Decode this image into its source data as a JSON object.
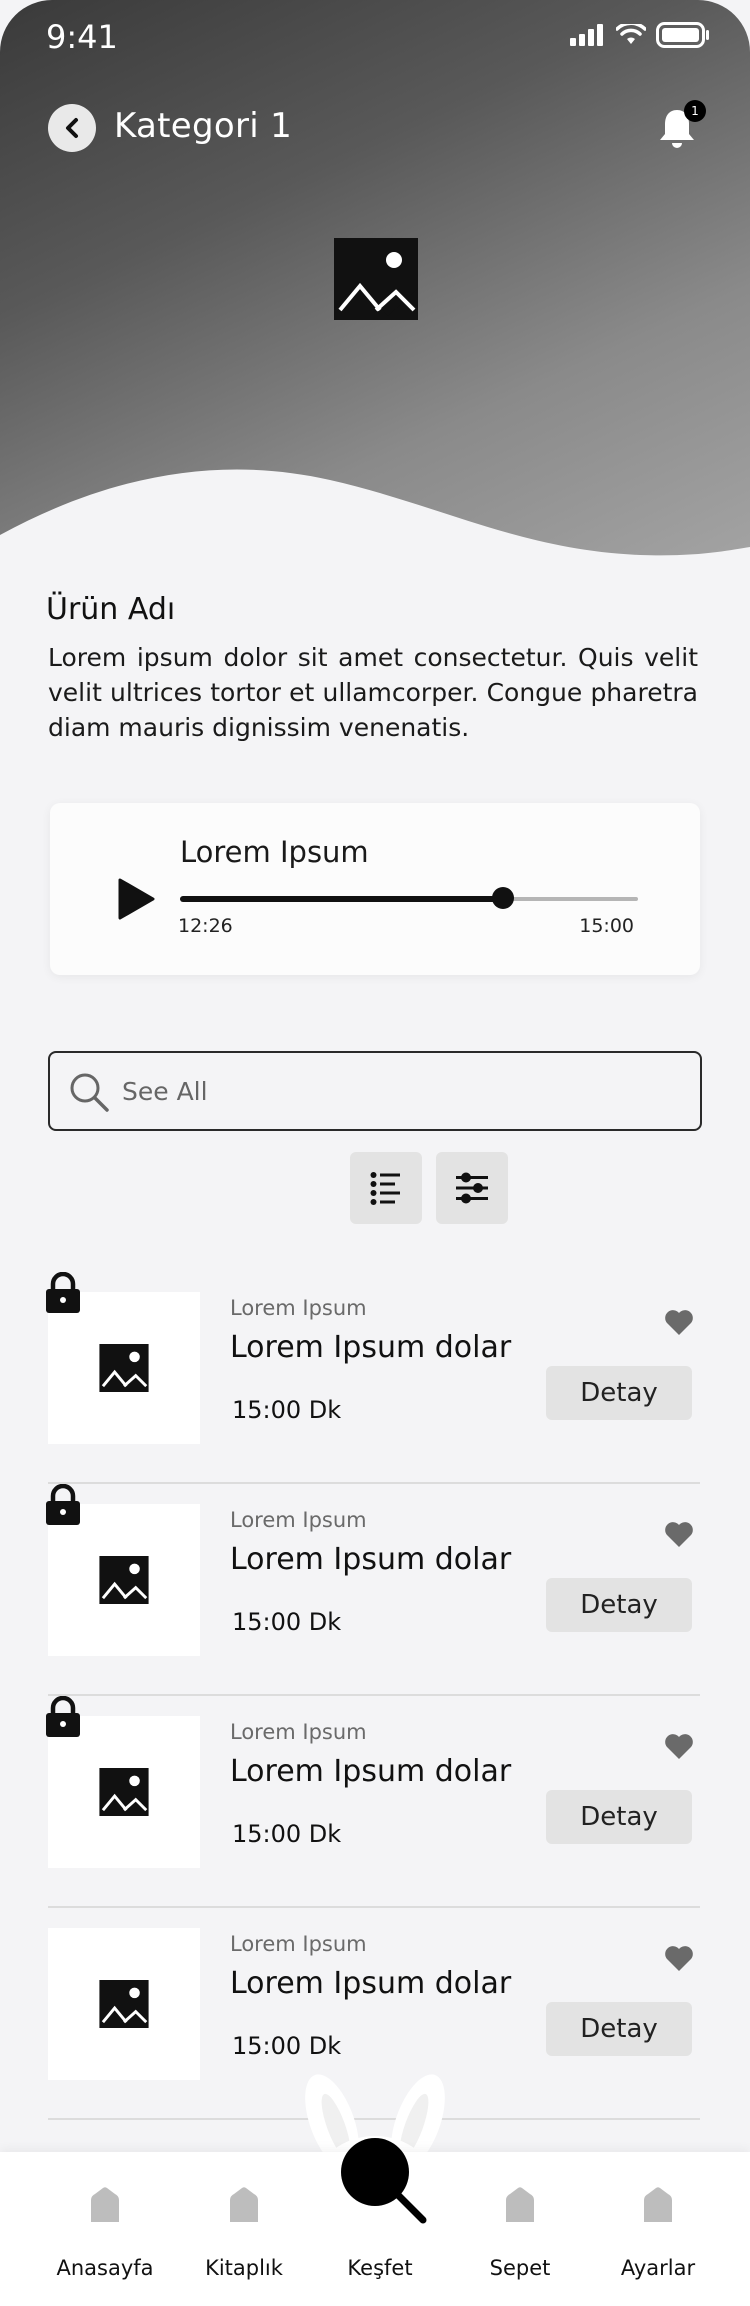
{
  "status": {
    "time": "9:41"
  },
  "header": {
    "title": "Kategori 1",
    "notification_count": "1"
  },
  "product": {
    "name": "Ürün Adı",
    "description": "Lorem ipsum dolor sit amet consectetur. Quis velit velit ultrices tortor et ullamcorper. Congue pharetra diam mauris dignissim venenatis."
  },
  "player": {
    "title": "Lorem Ipsum",
    "current_time": "12:26",
    "total_time": "15:00",
    "progress": 0.705
  },
  "search": {
    "placeholder": "See All"
  },
  "list": {
    "items": [
      {
        "subtitle": "Lorem Ipsum",
        "title": "Lorem Ipsum dolar",
        "duration": "15:00 Dk",
        "button": "Detay",
        "locked": true
      },
      {
        "subtitle": "Lorem Ipsum",
        "title": "Lorem Ipsum dolar",
        "duration": "15:00 Dk",
        "button": "Detay",
        "locked": true
      },
      {
        "subtitle": "Lorem Ipsum",
        "title": "Lorem Ipsum dolar",
        "duration": "15:00 Dk",
        "button": "Detay",
        "locked": true
      },
      {
        "subtitle": "Lorem Ipsum",
        "title": "Lorem Ipsum dolar",
        "duration": "15:00 Dk",
        "button": "Detay",
        "locked": false
      }
    ]
  },
  "nav": {
    "items": [
      {
        "label": "Anasayfa",
        "icon": "home-icon"
      },
      {
        "label": "Kitaplık",
        "icon": "home-icon"
      },
      {
        "label": "Keşfet",
        "icon": "search-icon"
      },
      {
        "label": "Sepet",
        "icon": "home-icon"
      },
      {
        "label": "Ayarlar",
        "icon": "home-icon"
      }
    ],
    "active": "Keşfet"
  }
}
